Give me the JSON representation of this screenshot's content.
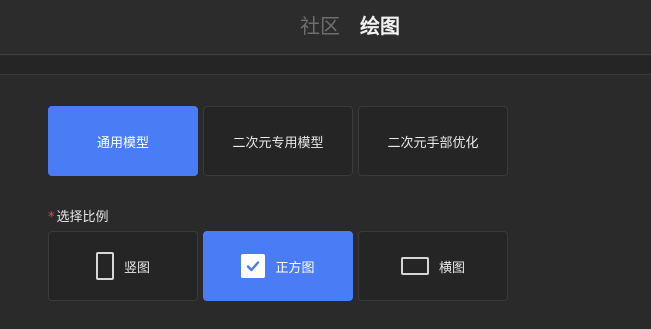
{
  "header": {
    "tabs": [
      {
        "label": "社区",
        "active": false
      },
      {
        "label": "绘图",
        "active": true
      }
    ]
  },
  "model": {
    "options": [
      {
        "label": "通用模型",
        "selected": true
      },
      {
        "label": "二次元专用模型",
        "selected": false
      },
      {
        "label": "二次元手部优化",
        "selected": false
      }
    ]
  },
  "ratio": {
    "required_mark": "*",
    "label": "选择比例",
    "options": [
      {
        "label": "竖图",
        "icon": "portrait-icon",
        "selected": false
      },
      {
        "label": "正方图",
        "icon": "checkbox-checked-icon",
        "selected": true
      },
      {
        "label": "横图",
        "icon": "landscape-icon",
        "selected": false
      }
    ]
  },
  "colors": {
    "accent": "#4a7cf6",
    "background": "#2a2a2a",
    "required": "#e24b4b"
  }
}
